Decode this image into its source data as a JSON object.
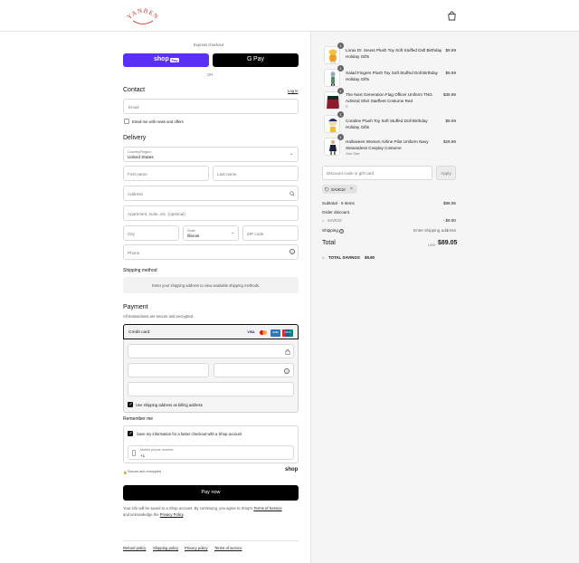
{
  "brand": {
    "logo_text": "YANBEN"
  },
  "checkout": {
    "express_label": "Express checkout",
    "shop_pay_label": "shop",
    "shop_pay_badge": "Pay",
    "gpay_label": "Pay",
    "or_label": "OR"
  },
  "contact": {
    "title": "Contact",
    "login_label": "Log in",
    "email_placeholder": "Email",
    "news_label": "Email me with news and offers"
  },
  "delivery": {
    "title": "Delivery",
    "country_label": "Country/Region",
    "country_value": "United States",
    "first_name_placeholder": "First name",
    "last_name_placeholder": "Last name",
    "address_placeholder": "Address",
    "apartment_placeholder": "Apartment, suite, etc. (optional)",
    "city_placeholder": "City",
    "state_label": "State",
    "state_value": "Illinois",
    "zip_placeholder": "ZIP code",
    "phone_placeholder": "Phone"
  },
  "shipping_method": {
    "title": "Shipping method",
    "notice": "Enter your shipping address to view available shipping methods."
  },
  "payment": {
    "title": "Payment",
    "subtitle": "All transactions are secure and encrypted.",
    "credit_card_label": "Credit card",
    "card_brands": [
      "VISA",
      "MC",
      "AMEX",
      "UNION"
    ],
    "billing_label": "Use shipping address as billing address"
  },
  "remember": {
    "title": "Remember me",
    "save_info_label": "Save my information for a faster checkout with a Shop account",
    "mobile_label": "Mobile phone number",
    "mobile_value": "+1",
    "secure_label": "Secure and encrypted",
    "shop_label": "shop"
  },
  "pay_now_label": "Pay now",
  "legal": {
    "text1": "Your info will be saved to a Shop account. By continuing, you agree to Shop's",
    "terms_link": "Terms of Service",
    "text2": "and acknowledge the",
    "privacy_link": "Privacy Policy",
    "text3": "."
  },
  "footer_links": [
    "Refund policy",
    "Shipping policy",
    "Privacy policy",
    "Terms of service"
  ],
  "order": {
    "items": [
      {
        "qty": "1",
        "name_line1": "Lorax Dr. Seuss Plush Toy Soft Stuffed Doll Birthday",
        "name_line2": "Holiday Gifts",
        "variant": "",
        "price": "$9.99"
      },
      {
        "qty": "1",
        "name_line1": "Salad Fingers Plush Toy Soft Stuffed Doll Birthday",
        "name_line2": "Holiday Gifts",
        "variant": "",
        "price": "$9.99"
      },
      {
        "qty": "1",
        "name_line1": "The Next Generation Flag Officer Uniform TNG",
        "name_line2": "Admiral Shirt Starfleet Costume Red",
        "variant": "S",
        "price": "$38.99"
      },
      {
        "qty": "1",
        "name_line1": "Coraline Plush Toy Soft Stuffed Doll Birthday",
        "name_line2": "Holiday Gifts",
        "variant": "",
        "price": "$9.99"
      },
      {
        "qty": "1",
        "name_line1": "Halloween Women Airline Pilot Uniform Navy",
        "name_line2": "Stewardess Cosplay Costume",
        "variant": "One Size",
        "price": "$29.99"
      }
    ],
    "discount_placeholder": "Discount code or gift card",
    "apply_label": "Apply",
    "applied_code": "SAVE10",
    "subtotal_label": "Subtotal · 5 items",
    "subtotal_value": "$98.95",
    "order_discount_label": "Order discount",
    "discount_code": "SAVE10",
    "discount_value": "- $9.90",
    "shipping_label": "Shipping",
    "shipping_value": "Enter shipping address",
    "total_label": "Total",
    "currency": "USD",
    "total_value": "$89.05",
    "savings_label": "TOTAL SAVINGS",
    "savings_value": "$9.90"
  },
  "colors": {
    "shop_pay": "#5a31f4",
    "primary": "#000000"
  }
}
